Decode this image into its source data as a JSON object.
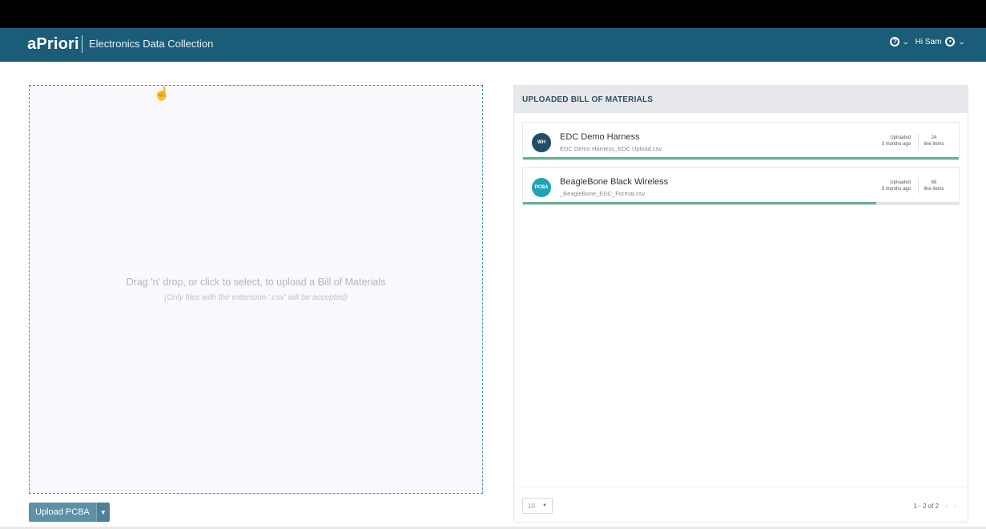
{
  "header": {
    "logo": "aPriori",
    "app_title": "Electronics Data Collection",
    "help_icon": "help-circle-icon",
    "greeting": "Hi Sam",
    "user_icon": "user-circle-icon",
    "colors": {
      "header_bg": "#1b5c78",
      "accent": "#3a96ab"
    }
  },
  "dropzone": {
    "main_text": "Drag 'n' drop, or click to select, to upload a Bill of Materials",
    "sub_text": "(Only files with the extension '.csv' will be accepted)"
  },
  "upload": {
    "label": "Upload PCBA"
  },
  "bom_panel": {
    "title": "UPLOADED BILL OF MATERIALS",
    "items": [
      {
        "badge": "WH",
        "name": "EDC Demo Harness",
        "file": "EDC Demo Harness_EDC Upload.csv",
        "uploaded_label": "Uploaded",
        "uploaded_when": "3 months ago",
        "count": "24",
        "count_label": "line items",
        "progress": 1.0
      },
      {
        "badge": "PCBA",
        "name": "BeagleBone Black Wireless",
        "file": "_BeagleBone_EDC_Format.csv",
        "uploaded_label": "Uploaded",
        "uploaded_when": "3 months ago",
        "count": "68",
        "count_label": "line items",
        "progress": 0.81
      }
    ],
    "page_size": "10",
    "range_text": "1 - 2 of 2"
  }
}
